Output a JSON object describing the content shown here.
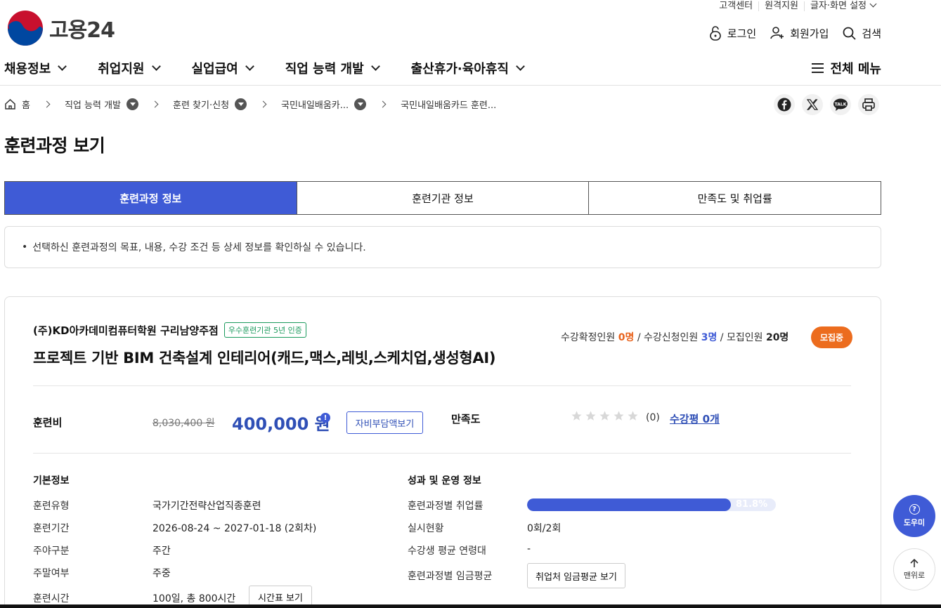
{
  "colors": {
    "accent": "#3f5bd6",
    "recruit": "#ec6c1e",
    "certified": "#1a9a5c"
  },
  "utility": {
    "customer_center": "고객센터",
    "remote_support": "원격지원",
    "text_settings": "글자·화면 설정"
  },
  "header": {
    "logo_text": "고용24",
    "login": "로그인",
    "signup": "회원가입",
    "search": "검색"
  },
  "gnb": {
    "items": [
      {
        "label": "채용정보"
      },
      {
        "label": "취업지원"
      },
      {
        "label": "실업급여"
      },
      {
        "label": "직업 능력 개발"
      },
      {
        "label": "출산휴가·육아휴직"
      }
    ],
    "all_menu": "전체 메뉴"
  },
  "breadcrumb": {
    "home": "홈",
    "items": [
      {
        "label": "직업 능력 개발"
      },
      {
        "label": "훈련 찾기·신청"
      },
      {
        "label": "국민내일배움카..."
      },
      {
        "label": "국민내일배움카드 훈련..."
      }
    ]
  },
  "share_icons": [
    "facebook-icon",
    "x-icon",
    "kakaotalk-icon",
    "print-icon"
  ],
  "kakaotalk_icon_text": "TALK",
  "page_title": "훈련과정 보기",
  "tabs": [
    {
      "label": "훈련과정 정보",
      "active": true
    },
    {
      "label": "훈련기관 정보",
      "active": false
    },
    {
      "label": "만족도 및 취업률",
      "active": false
    }
  ],
  "notice": "선택하신 훈련과정의 목표, 내용, 수강 조건 등 상세 정보를 확인하실 수 있습니다.",
  "course": {
    "institution": "(주)KD아카데미컴퓨터학원 구리남양주점",
    "cert_badge": "우수훈련기관 5년 인증",
    "title": "프로젝트 기반 BIM 건축설계 인테리어(캐드,맥스,레빗,스케치업,생성형AI)",
    "stats": {
      "confirmed_label": "수강확정인원",
      "confirmed_value": "0명",
      "applied_label": "수강신청인원",
      "applied_value": "3명",
      "recruit_label": "모집인원",
      "recruit_value": "20명",
      "separator": "/"
    },
    "status_badge": "모집중",
    "fee_label": "훈련비",
    "fee_original": "8,030,400 원",
    "fee_current": "400,000 원",
    "info_icon_text": "!",
    "self_pay_button": "자비부담액보기",
    "satisfaction_label": "만족도",
    "rating_stars": 0,
    "rating_max": 5,
    "rating_count": "(0)",
    "review_link": "수강평 0개"
  },
  "basic_info": {
    "title": "기본정보",
    "rows": [
      {
        "label": "훈련유형",
        "value": "국가기간전략산업직종훈련"
      },
      {
        "label": "훈련기간",
        "value": "2026-08-24 ~ 2027-01-18 (2회차)"
      },
      {
        "label": "주야구분",
        "value": "주간"
      },
      {
        "label": "주말여부",
        "value": "주중"
      },
      {
        "label": "훈련시간",
        "value": "100일, 총 800시간"
      }
    ],
    "timetable_button": "시간표 보기"
  },
  "perf_info": {
    "title": "성과 및 운영 정보",
    "employment_label": "훈련과정별 취업률",
    "employment_rate": 81.8,
    "employment_rate_text": "81.8%",
    "status_label": "실시현황",
    "status_value": "0회/2회",
    "age_label": "수강생 평균 연령대",
    "age_value": "-",
    "wage_label": "훈련과정별 임금평균",
    "wage_button": "취업처 임금평균 보기"
  },
  "floating": {
    "help": "도우미",
    "help_icon_text": "?",
    "top": "맨위로"
  }
}
